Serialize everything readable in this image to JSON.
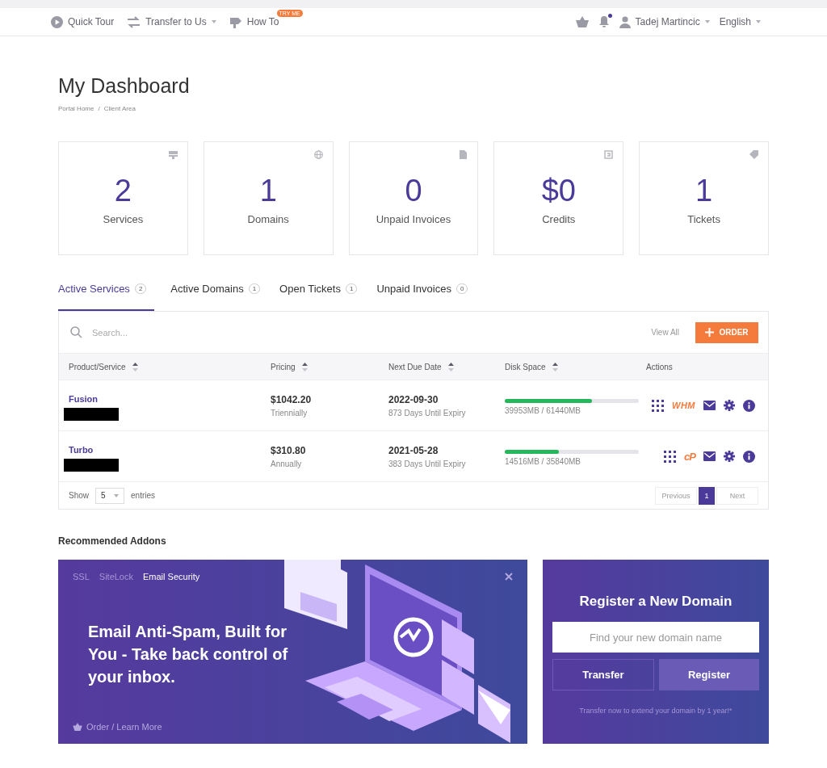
{
  "topbar": {
    "links": [
      {
        "label": "Quick Tour",
        "caret": false
      },
      {
        "label": "Transfer to Us",
        "caret": true
      },
      {
        "label": "How To",
        "caret": false,
        "badge": "TRY ME"
      }
    ],
    "notification": true,
    "user": "Tadej Martincic",
    "language": "English"
  },
  "page": {
    "title": "My Dashboard",
    "breadcrumb": [
      "Portal Home",
      "Client Area"
    ],
    "separator": "/"
  },
  "stats": [
    {
      "value": "2",
      "label": "Services"
    },
    {
      "value": "1",
      "label": "Domains"
    },
    {
      "value": "0",
      "label": "Unpaid Invoices"
    },
    {
      "value": "$0",
      "label": "Credits"
    },
    {
      "value": "1",
      "label": "Tickets"
    }
  ],
  "tabs": [
    {
      "label": "Active Services",
      "count": "2",
      "selected": true
    },
    {
      "label": "Active Domains",
      "count": "1",
      "selected": false
    },
    {
      "label": "Open Tickets",
      "count": "1",
      "selected": false
    },
    {
      "label": "Unpaid Invoices",
      "count": "0",
      "selected": false
    }
  ],
  "table": {
    "search": {
      "placeholder": "Search..."
    },
    "view_all": "View All",
    "order": "ORDER",
    "columns": [
      {
        "label": "Product/Service",
        "sortable": true
      },
      {
        "label": "Pricing",
        "sortable": true
      },
      {
        "label": "Next Due Date",
        "sortable": true
      },
      {
        "label": "Disk Space",
        "sortable": true
      },
      {
        "label": "Actions",
        "sortable": false
      }
    ],
    "rows": [
      {
        "product": "Fusion",
        "redacted": true,
        "price": "$1042.20",
        "cycle": "Triennially",
        "due": "2022-09-30",
        "expiry": "873 Days Until Expiry",
        "level": 0.65,
        "disk": "39953MB / 61440MB",
        "panel": {
          "kind": "whm",
          "label": "WHM"
        }
      },
      {
        "product": "Turbo",
        "redacted": true,
        "price": "$310.80",
        "cycle": "Annually",
        "due": "2021-05-28",
        "expiry": "383 Days Until Expiry",
        "level": 0.405,
        "disk": "14516MB / 35840MB",
        "panel": {
          "kind": "cp",
          "label": "cP"
        }
      }
    ],
    "show": "Show",
    "entries_value": "5",
    "entries": "entries",
    "pagination": [
      {
        "label": "Previous",
        "kind": "nav",
        "selected": false
      },
      {
        "label": "1",
        "kind": "page",
        "selected": true
      },
      {
        "label": "Next",
        "kind": "nav",
        "selected": false
      }
    ]
  },
  "addons": {
    "heading": "Recommended Addons",
    "tabs": [
      {
        "label": "SSL",
        "selected": false
      },
      {
        "label": "SiteLock",
        "selected": false
      },
      {
        "label": "Email Security",
        "selected": true
      }
    ],
    "headline": "Email Anti-Spam, Built for You - Take back control of your inbox.",
    "link": "Order / Learn More"
  },
  "domain": {
    "title": "Register a New Domain",
    "placeholder": "Find your new domain name",
    "transfer": "Transfer",
    "register": "Register",
    "note": "Transfer now to extend your domain by 1 year!*"
  }
}
